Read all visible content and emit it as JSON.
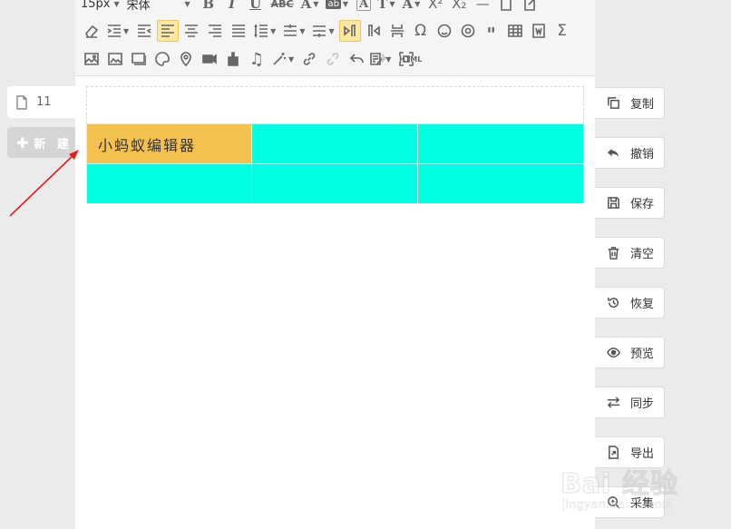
{
  "toolbar": {
    "font_size": "15px",
    "font_family": "宋体",
    "html_label": "HTML",
    "row1_icons": [
      "bold-icon",
      "italic-icon",
      "underline-icon",
      "strikethrough-icon",
      "font-color-icon",
      "background-color-icon",
      "text-frame-icon",
      "text-effect-icon",
      "font-style-icon",
      "superscript-icon",
      "subscript-icon",
      "horizontal-line-icon",
      "blank-page-icon",
      "export-page-icon"
    ],
    "row2_icons": [
      "eraser-icon",
      "indent-icon",
      "outdent-icon",
      "align-left-icon",
      "align-center-icon",
      "align-right-icon",
      "justify-icon",
      "line-spacing-icon",
      "paragraph-before-icon",
      "paragraph-after-icon",
      "ltr-icon",
      "rtl-icon",
      "page-break-icon",
      "special-char-icon",
      "emoticon-icon",
      "at-mention-icon",
      "quote-icon",
      "table-icon",
      "word-import-icon",
      "sum-icon"
    ],
    "row3_icons": [
      "image-icon",
      "multi-image-icon",
      "background-image-icon",
      "color-palette-icon",
      "map-icon",
      "video-icon",
      "format-brush-icon",
      "music-icon",
      "magic-wand-icon",
      "link-icon",
      "unlink-icon",
      "undo-icon",
      "redo-icon",
      "template-icon",
      "fullscreen-icon"
    ]
  },
  "document": {
    "cells": [
      [
        "小蚂蚁编辑器",
        "",
        ""
      ],
      [
        "",
        "",
        ""
      ]
    ],
    "highlight_color": "#f4c050",
    "table_color": "#00ffe1"
  },
  "left_panel": {
    "file_name": "11",
    "new_label": "新 建"
  },
  "actions": [
    {
      "label": "复制",
      "icon": "copy-icon"
    },
    {
      "label": "撤销",
      "icon": "undo-icon"
    },
    {
      "label": "保存",
      "icon": "save-icon"
    },
    {
      "label": "清空",
      "icon": "trash-icon"
    },
    {
      "label": "恢复",
      "icon": "restore-icon"
    },
    {
      "label": "预览",
      "icon": "eye-icon"
    },
    {
      "label": "同步",
      "icon": "sync-icon"
    },
    {
      "label": "导出",
      "icon": "export-icon"
    },
    {
      "label": "采集",
      "icon": "collect-icon"
    }
  ],
  "watermark": {
    "main": "Bai  经验",
    "sub": "jingyan.baidu.com"
  },
  "colors": {
    "accent_arrow": "#e0201c",
    "active_button": "#fde8a4"
  }
}
